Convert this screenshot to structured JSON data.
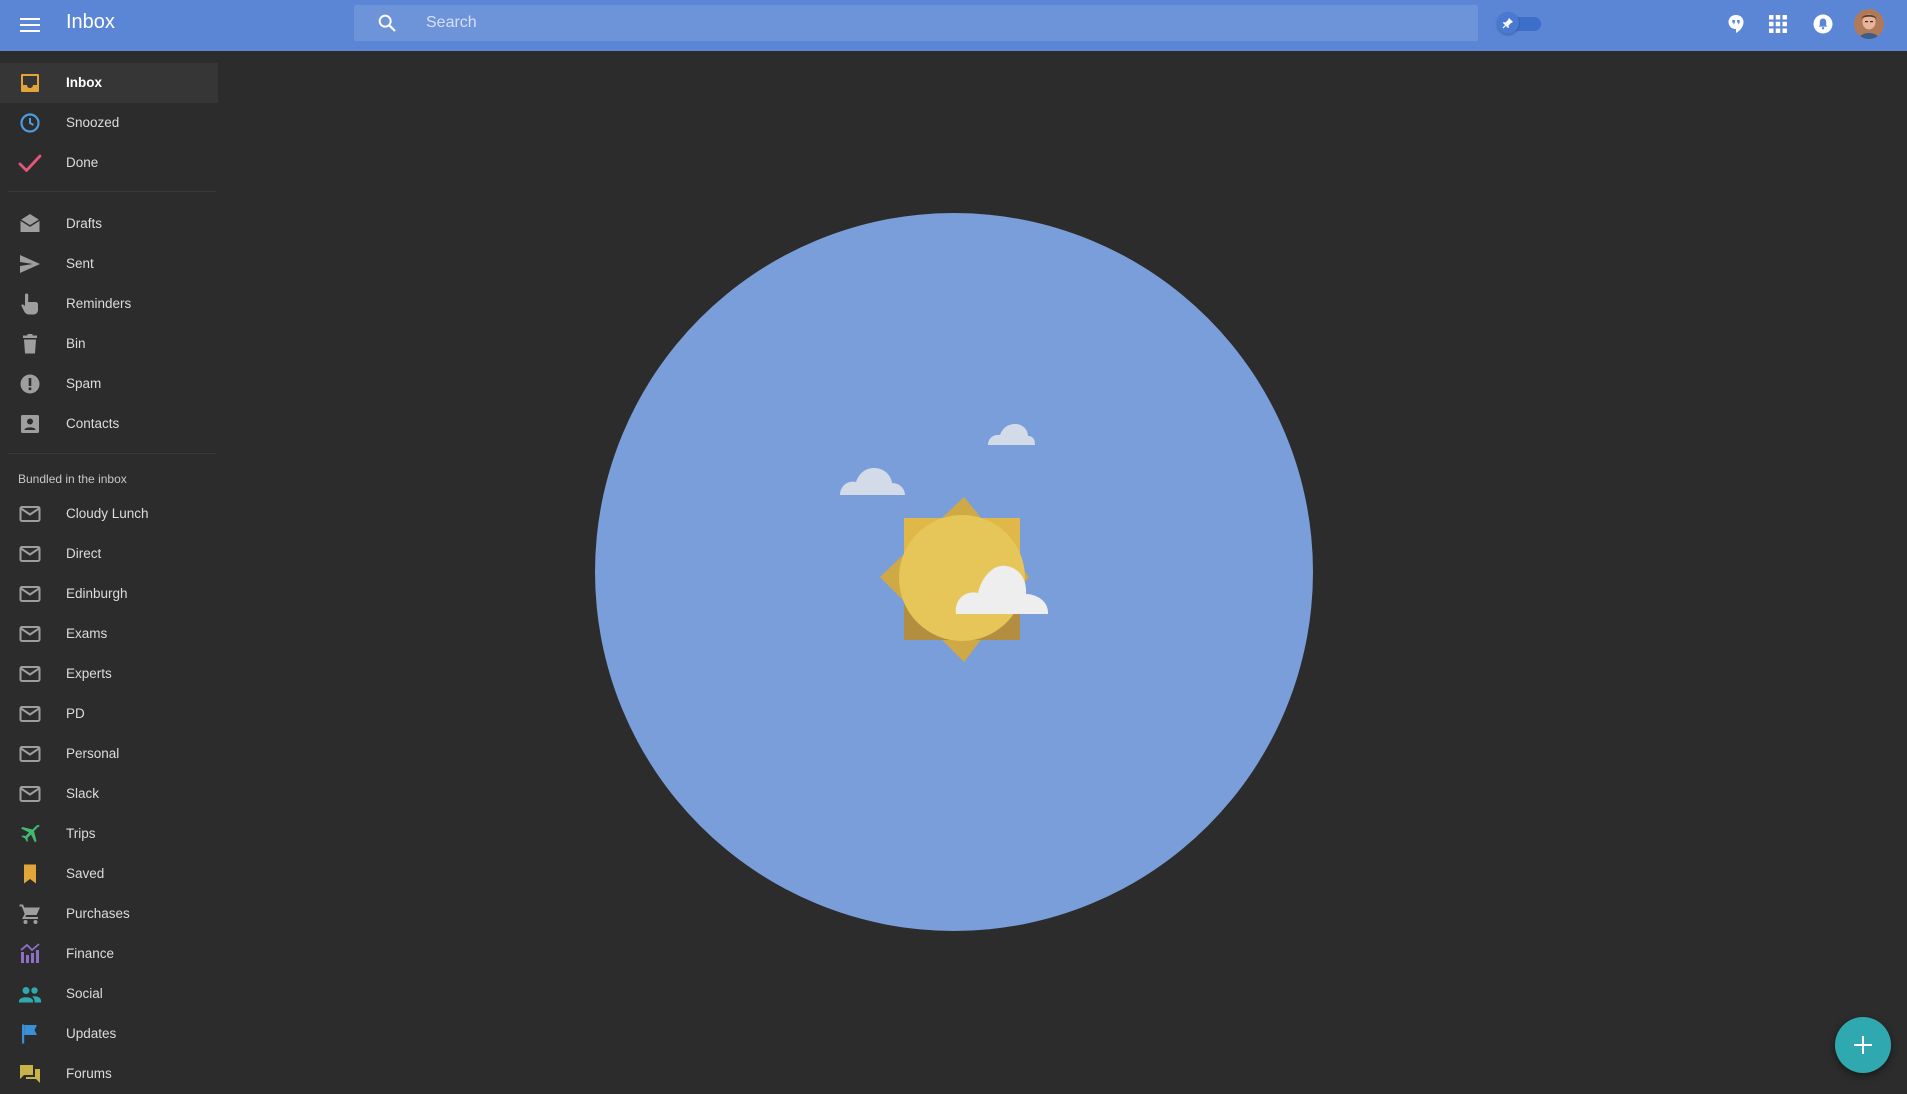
{
  "header": {
    "title": "Inbox",
    "search_placeholder": "Search",
    "search_value": ""
  },
  "nav": {
    "primary": [
      {
        "label": "Inbox",
        "icon": "inbox-icon",
        "color": "#e0a63a",
        "active": true
      },
      {
        "label": "Snoozed",
        "icon": "clock-icon",
        "color": "#4a9de0"
      },
      {
        "label": "Done",
        "icon": "check-icon",
        "color": "#e2577a"
      }
    ],
    "system": [
      {
        "label": "Drafts",
        "icon": "drafts-icon"
      },
      {
        "label": "Sent",
        "icon": "send-icon"
      },
      {
        "label": "Reminders",
        "icon": "reminder-hand-icon"
      },
      {
        "label": "Bin",
        "icon": "trash-icon"
      },
      {
        "label": "Spam",
        "icon": "spam-icon"
      },
      {
        "label": "Contacts",
        "icon": "contacts-icon"
      }
    ],
    "bundles_heading": "Bundled in the inbox",
    "bundles": [
      {
        "label": "Cloudy Lunch",
        "icon": "mail-icon"
      },
      {
        "label": "Direct",
        "icon": "mail-icon"
      },
      {
        "label": "Edinburgh",
        "icon": "mail-icon"
      },
      {
        "label": "Exams",
        "icon": "mail-icon"
      },
      {
        "label": "Experts",
        "icon": "mail-icon"
      },
      {
        "label": "PD",
        "icon": "mail-icon"
      },
      {
        "label": "Personal",
        "icon": "mail-icon"
      },
      {
        "label": "Slack",
        "icon": "mail-icon"
      },
      {
        "label": "Trips",
        "icon": "plane-icon",
        "color": "#43b86f"
      },
      {
        "label": "Saved",
        "icon": "bookmark-icon",
        "color": "#e0a63a"
      },
      {
        "label": "Purchases",
        "icon": "cart-icon",
        "color": "#9e9e9e"
      },
      {
        "label": "Finance",
        "icon": "finance-chart-icon",
        "color": "#8e6fc7"
      },
      {
        "label": "Social",
        "icon": "people-icon",
        "color": "#2fa8b0"
      },
      {
        "label": "Updates",
        "icon": "flag-icon",
        "color": "#3a8fd6"
      },
      {
        "label": "Forums",
        "icon": "forum-icon",
        "color": "#c8b24a"
      }
    ]
  },
  "colors": {
    "header": "#5b86d6",
    "background": "#2c2c2c",
    "hero_circle": "#7a9ed9",
    "sun": "#e5c24e",
    "fab": "#2fa8b0"
  }
}
